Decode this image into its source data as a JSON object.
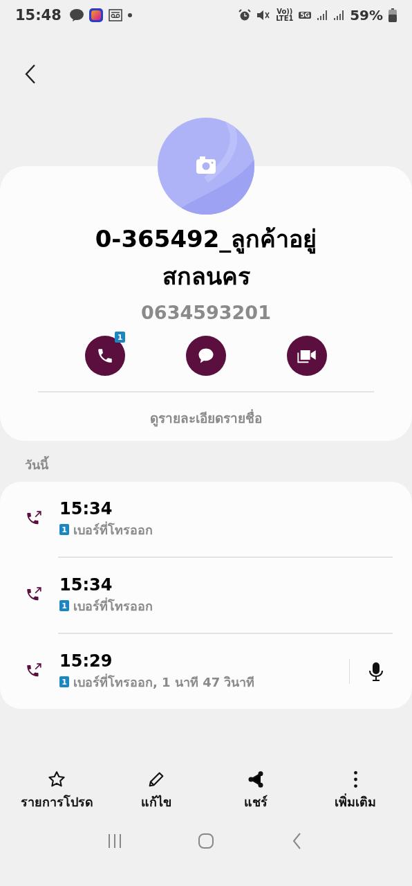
{
  "status_bar": {
    "time": "15:48",
    "volte": "Vo))",
    "lte": "LTE1",
    "network_type": "5G",
    "battery": "59%"
  },
  "contact": {
    "name": "0-365492_ลูกค้าอยู่สกลนคร",
    "phone": "0634593201"
  },
  "actions": [
    {
      "kind": "call",
      "badge": "1"
    },
    {
      "kind": "message"
    },
    {
      "kind": "video"
    }
  ],
  "details_link": "ดูรายละเอียดรายชื่อ",
  "section_label": "วันนี้",
  "calls": [
    {
      "time": "15:34",
      "sim": "1",
      "detail": "เบอร์ที่โทรออก",
      "recording": false
    },
    {
      "time": "15:34",
      "sim": "1",
      "detail": "เบอร์ที่โทรออก",
      "recording": false
    },
    {
      "time": "15:29",
      "sim": "1",
      "detail": "เบอร์ที่โทรออก, 1 นาที 47 วินาที",
      "recording": true
    }
  ],
  "bottom_actions": [
    {
      "kind": "favorite",
      "label": "รายการโปรด"
    },
    {
      "kind": "edit",
      "label": "แก้ไข"
    },
    {
      "kind": "share",
      "label": "แชร์"
    },
    {
      "kind": "more",
      "label": "เพิ่มเติม"
    }
  ]
}
